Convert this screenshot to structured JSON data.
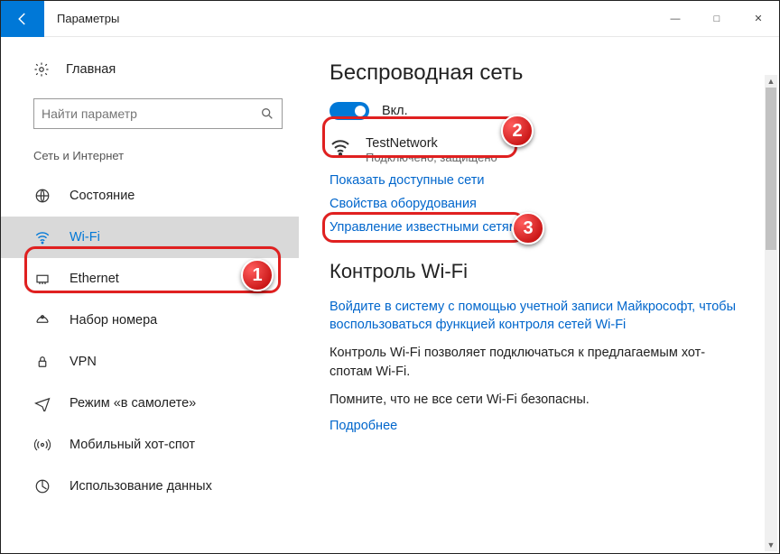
{
  "titlebar": {
    "title": "Параметры"
  },
  "sidebar": {
    "home": "Главная",
    "search_placeholder": "Найти параметр",
    "category": "Сеть и Интернет",
    "items": [
      {
        "label": "Состояние"
      },
      {
        "label": "Wi-Fi"
      },
      {
        "label": "Ethernet"
      },
      {
        "label": "Набор номера"
      },
      {
        "label": "VPN"
      },
      {
        "label": "Режим «в самолете»"
      },
      {
        "label": "Мобильный хот-спот"
      },
      {
        "label": "Использование данных"
      }
    ]
  },
  "content": {
    "heading1": "Беспроводная сеть",
    "toggle_label": "Вкл.",
    "network": {
      "name": "TestNetwork",
      "status": "Подключено, защищено"
    },
    "link_show": "Показать доступные сети",
    "link_hw": "Свойства оборудования",
    "link_known": "Управление известными сетями",
    "heading2": "Контроль Wi-Fi",
    "link_signin": "Войдите в систему с помощью учетной записи Майкрософт, чтобы воспользоваться функцией контроля сетей Wi-Fi",
    "para1": "Контроль Wi-Fi позволяет подключаться к предлагаемым хот-спотам Wi-Fi.",
    "para2": "Помните, что не все сети Wi-Fi безопасны.",
    "link_more": "Подробнее"
  },
  "annotations": {
    "n1": "1",
    "n2": "2",
    "n3": "3"
  }
}
